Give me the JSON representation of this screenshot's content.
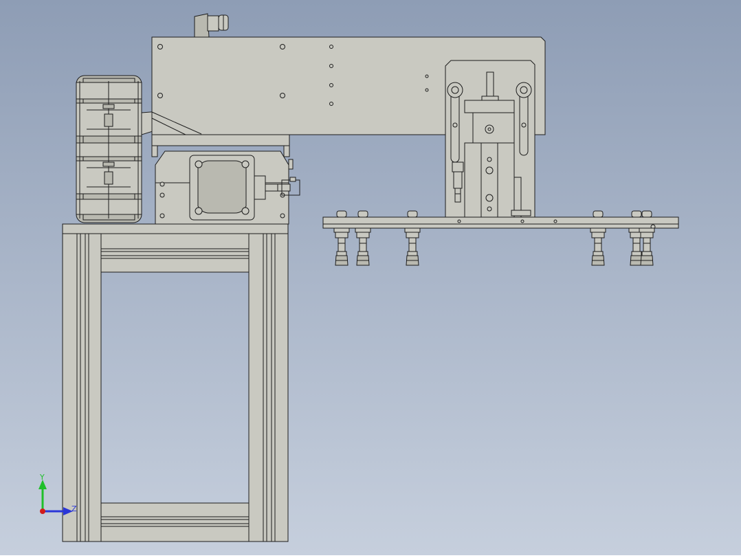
{
  "viewport": {
    "background_top": "#8e9db5",
    "background_bottom": "#c6cfdd",
    "part_fill": "#c9c9c1",
    "part_fill_dark": "#b9b9b0",
    "edge_color": "#1c1c1c"
  },
  "triad": {
    "y_label": "Y",
    "z_label": "Z",
    "y_color": "#1fbf2a",
    "z_color": "#2a36d8",
    "x_color": "#d21c1c"
  }
}
